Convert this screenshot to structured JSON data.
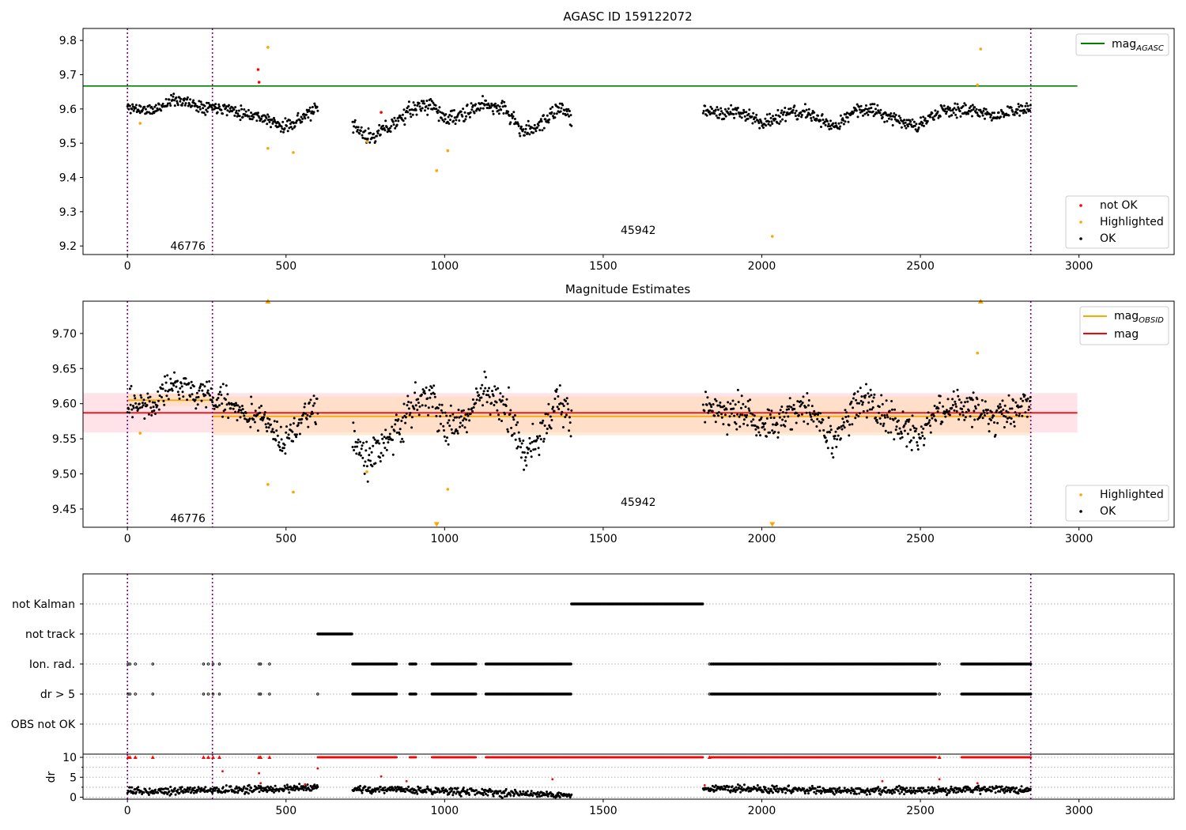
{
  "figure": {
    "top_title": "AGASC ID 159122072",
    "middle_title": "Magnitude Estimates",
    "colors": {
      "ok": "#000000",
      "not_ok": "#ff0000",
      "highlighted": "#ffa500",
      "agasc_line": "#008000",
      "obs_line": "#ffa500",
      "mag_line": "#ff0000",
      "mag_band": "#ffc0cb",
      "obs_band": "#ffdab0",
      "obs_boundary": "#800080"
    }
  },
  "chart_data": [
    {
      "type": "scatter",
      "title": "AGASC ID 159122072",
      "xlim": [
        -140,
        3300
      ],
      "ylim": [
        9.175,
        9.835
      ],
      "x_ticks": [
        0,
        500,
        1000,
        1500,
        2000,
        2500,
        3000
      ],
      "y_ticks": [
        9.2,
        9.3,
        9.4,
        9.5,
        9.6,
        9.7,
        9.8
      ],
      "obs_boundaries": [
        0,
        268,
        2848
      ],
      "obsid_labels": [
        {
          "text": "46776",
          "x": 135,
          "y": 9.2
        },
        {
          "text": "45942",
          "x": 1555,
          "y": 9.247
        }
      ],
      "reference_lines": [
        {
          "name": "mag_AGASC",
          "y": 9.667,
          "x_range": [
            -140,
            2995
          ]
        }
      ],
      "legend_top": {
        "position": "upper right",
        "entries": [
          {
            "label": "mag",
            "sub": "AGASC"
          }
        ]
      },
      "legend_bottom": {
        "position": "lower right",
        "entries": [
          "not OK",
          "Highlighted",
          "OK"
        ]
      },
      "segments": [
        {
          "start": 0,
          "end": 600,
          "step": 2,
          "knots": [
            [
              0,
              9.605
            ],
            [
              80,
              9.595
            ],
            [
              150,
              9.63
            ],
            [
              220,
              9.61
            ],
            [
              300,
              9.605
            ],
            [
              380,
              9.585
            ],
            [
              430,
              9.575
            ],
            [
              490,
              9.545
            ],
            [
              540,
              9.57
            ],
            [
              600,
              9.6
            ]
          ],
          "noise": 0.012
        },
        {
          "start": 710,
          "end": 1400,
          "step": 2,
          "knots": [
            [
              710,
              9.55
            ],
            [
              760,
              9.515
            ],
            [
              820,
              9.545
            ],
            [
              900,
              9.6
            ],
            [
              960,
              9.615
            ],
            [
              1000,
              9.57
            ],
            [
              1060,
              9.58
            ],
            [
              1120,
              9.615
            ],
            [
              1190,
              9.6
            ],
            [
              1250,
              9.53
            ],
            [
              1300,
              9.555
            ],
            [
              1360,
              9.6
            ],
            [
              1400,
              9.58
            ]
          ],
          "noise": 0.015
        },
        {
          "start": 1815,
          "end": 2848,
          "step": 2,
          "knots": [
            [
              1815,
              9.6
            ],
            [
              1870,
              9.585
            ],
            [
              1940,
              9.59
            ],
            [
              2000,
              9.56
            ],
            [
              2080,
              9.585
            ],
            [
              2140,
              9.59
            ],
            [
              2230,
              9.545
            ],
            [
              2290,
              9.595
            ],
            [
              2350,
              9.6
            ],
            [
              2440,
              9.565
            ],
            [
              2490,
              9.55
            ],
            [
              2560,
              9.59
            ],
            [
              2650,
              9.6
            ],
            [
              2720,
              9.58
            ],
            [
              2848,
              9.6
            ]
          ],
          "noise": 0.013
        }
      ],
      "series": [
        {
          "name": "not OK",
          "points": [
            [
              412,
              9.715
            ],
            [
              415,
              9.678
            ],
            [
              800,
              9.59
            ]
          ]
        },
        {
          "name": "Highlighted",
          "points": [
            [
              40,
              9.558
            ],
            [
              443,
              9.78
            ],
            [
              443,
              9.485
            ],
            [
              523,
              9.473
            ],
            [
              755,
              9.505
            ],
            [
              975,
              9.42
            ],
            [
              1010,
              9.478
            ],
            [
              2033,
              9.228
            ],
            [
              2680,
              9.67
            ],
            [
              2690,
              9.775
            ]
          ]
        }
      ]
    },
    {
      "type": "scatter",
      "title": "Magnitude Estimates",
      "xlim": [
        -140,
        3300
      ],
      "ylim": [
        9.424,
        9.746
      ],
      "x_ticks": [
        0,
        500,
        1000,
        1500,
        2000,
        2500,
        3000
      ],
      "y_ticks": [
        9.45,
        9.5,
        9.55,
        9.6,
        9.65,
        9.7
      ],
      "obs_boundaries": [
        0,
        268,
        2848
      ],
      "obsid_labels": [
        {
          "text": "46776",
          "x": 135,
          "y": 9.437
        },
        {
          "text": "45942",
          "x": 1555,
          "y": 9.46
        }
      ],
      "reference_lines": [
        {
          "name": "mag",
          "y": 9.587,
          "x_range": [
            -140,
            2995
          ]
        },
        {
          "name": "mag_OBSID 46776",
          "y": 9.605,
          "x_range": [
            0,
            268
          ]
        },
        {
          "name": "mag_OBSID 45942",
          "y": 9.582,
          "x_range": [
            268,
            2848
          ]
        }
      ],
      "bands": [
        {
          "name": "mag band",
          "y_range": [
            9.559,
            9.615
          ],
          "x_range": [
            -140,
            2995
          ]
        },
        {
          "name": "obsid band 46776",
          "y_range": [
            9.596,
            9.614
          ],
          "x_range": [
            0,
            268
          ]
        },
        {
          "name": "obsid band 45942",
          "y_range": [
            9.555,
            9.61
          ],
          "x_range": [
            268,
            2848
          ]
        }
      ],
      "legend_top": {
        "position": "upper right",
        "entries": [
          {
            "label": "mag",
            "sub": "OBSID"
          },
          {
            "label": "mag",
            "sub": ""
          }
        ]
      },
      "legend_bottom": {
        "position": "lower right",
        "entries": [
          "Highlighted",
          "OK"
        ]
      },
      "segments": [
        {
          "start": 0,
          "end": 600,
          "step": 2,
          "knots": [
            [
              0,
              9.605
            ],
            [
              80,
              9.595
            ],
            [
              150,
              9.63
            ],
            [
              220,
              9.615
            ],
            [
              300,
              9.605
            ],
            [
              380,
              9.585
            ],
            [
              430,
              9.58
            ],
            [
              490,
              9.54
            ],
            [
              540,
              9.57
            ],
            [
              600,
              9.6
            ]
          ],
          "noise": 0.014
        },
        {
          "start": 710,
          "end": 1400,
          "step": 2,
          "knots": [
            [
              710,
              9.55
            ],
            [
              760,
              9.515
            ],
            [
              820,
              9.545
            ],
            [
              900,
              9.6
            ],
            [
              960,
              9.615
            ],
            [
              1000,
              9.565
            ],
            [
              1060,
              9.575
            ],
            [
              1120,
              9.615
            ],
            [
              1190,
              9.6
            ],
            [
              1250,
              9.53
            ],
            [
              1300,
              9.555
            ],
            [
              1360,
              9.6
            ],
            [
              1400,
              9.58
            ]
          ],
          "noise": 0.018
        },
        {
          "start": 1815,
          "end": 2848,
          "step": 2,
          "knots": [
            [
              1815,
              9.6
            ],
            [
              1870,
              9.585
            ],
            [
              1940,
              9.59
            ],
            [
              2000,
              9.56
            ],
            [
              2080,
              9.585
            ],
            [
              2140,
              9.595
            ],
            [
              2230,
              9.545
            ],
            [
              2290,
              9.6
            ],
            [
              2350,
              9.6
            ],
            [
              2440,
              9.565
            ],
            [
              2490,
              9.55
            ],
            [
              2560,
              9.59
            ],
            [
              2650,
              9.6
            ],
            [
              2720,
              9.58
            ],
            [
              2848,
              9.6
            ]
          ],
          "noise": 0.016
        }
      ],
      "series": [
        {
          "name": "Highlighted",
          "points": [
            [
              40,
              9.558
            ],
            [
              443,
              9.485
            ],
            [
              523,
              9.474
            ],
            [
              755,
              9.503
            ],
            [
              1010,
              9.478
            ],
            [
              2680,
              9.672
            ]
          ]
        },
        {
          "name": "Highlighted (off-axis high)",
          "points": [
            [
              443,
              9.746
            ],
            [
              2690,
              9.746
            ]
          ]
        },
        {
          "name": "Highlighted (off-axis low)",
          "points": [
            [
              975,
              9.428
            ],
            [
              2033,
              9.428
            ]
          ]
        }
      ]
    },
    {
      "type": "scatter",
      "title": "",
      "xlim": [
        -140,
        3300
      ],
      "categories": [
        "not Kalman",
        "not track",
        "Ion. rad.",
        "dr > 5",
        "OBS not OK"
      ],
      "obs_boundaries": [
        0,
        268,
        2848
      ],
      "flag_ranges": {
        "not Kalman": [
          [
            1400,
            1815
          ]
        ],
        "not track": [
          [
            600,
            710
          ]
        ],
        "Ion. rad.": [
          [
            710,
            850
          ],
          [
            890,
            910
          ],
          [
            960,
            1100
          ],
          [
            1130,
            1400
          ],
          [
            1840,
            2550
          ],
          [
            2630,
            2848
          ]
        ],
        "dr > 5": [
          [
            710,
            850
          ],
          [
            890,
            910
          ],
          [
            960,
            1100
          ],
          [
            1130,
            1400
          ],
          [
            1840,
            2550
          ],
          [
            2630,
            2848
          ]
        ],
        "OBS not OK": []
      },
      "flag_sparse": {
        "Ion. rad.": [
          2,
          8,
          25,
          80,
          240,
          255,
          270,
          290,
          415,
          420,
          448,
          1835,
          2560
        ],
        "dr > 5": [
          2,
          8,
          25,
          80,
          240,
          255,
          270,
          290,
          415,
          420,
          448,
          600,
          1835,
          2560
        ]
      }
    },
    {
      "type": "scatter",
      "title": "",
      "ylabel": "dr",
      "xlim": [
        -140,
        3300
      ],
      "ylim": [
        -0.5,
        10.8
      ],
      "x_ticks": [
        0,
        500,
        1000,
        1500,
        2000,
        2500,
        3000
      ],
      "y_ticks": [
        0,
        5,
        10
      ],
      "obs_boundaries": [
        0,
        268,
        2848
      ],
      "clip_value": 10,
      "segments": [
        {
          "start": 0,
          "end": 600,
          "step": 2,
          "knots": [
            [
              0,
              1.5
            ],
            [
              300,
              1.8
            ],
            [
              600,
              2.3
            ]
          ],
          "noise": 0.6
        },
        {
          "start": 710,
          "end": 1400,
          "step": 2,
          "knots": [
            [
              710,
              2.0
            ],
            [
              1000,
              1.6
            ],
            [
              1400,
              0.5
            ]
          ],
          "noise": 0.6
        },
        {
          "start": 1815,
          "end": 2848,
          "step": 2,
          "knots": [
            [
              1815,
              2.2
            ],
            [
              2300,
              1.6
            ],
            [
              2848,
              1.8
            ]
          ],
          "noise": 0.6
        }
      ],
      "clipped_ranges": [
        [
          600,
          710
        ],
        [
          710,
          850
        ],
        [
          890,
          910
        ],
        [
          960,
          1100
        ],
        [
          1130,
          1815
        ],
        [
          1840,
          2550
        ],
        [
          2630,
          2848
        ]
      ],
      "clipped_sparse": [
        2,
        8,
        25,
        80,
        240,
        255,
        270,
        290,
        415,
        420,
        448,
        1835,
        2560
      ],
      "red_points": [
        [
          600,
          7.2
        ],
        [
          300,
          6.5
        ],
        [
          415,
          6.0
        ],
        [
          800,
          5.2
        ],
        [
          420,
          3.5
        ],
        [
          560,
          3.2
        ],
        [
          880,
          4.0
        ],
        [
          1820,
          3.0
        ],
        [
          2380,
          4.0
        ],
        [
          2560,
          4.5
        ],
        [
          2680,
          3.5
        ],
        [
          1340,
          4.5
        ]
      ]
    }
  ]
}
